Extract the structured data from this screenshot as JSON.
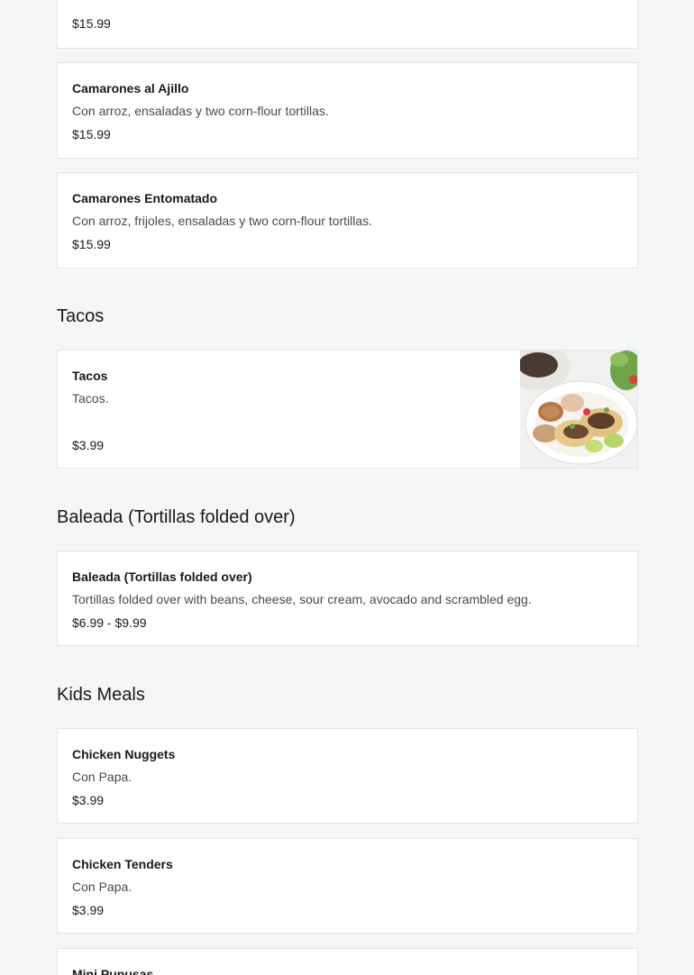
{
  "menu": {
    "top_partial_item": {
      "price": "$15.99"
    },
    "mariscos_items": [
      {
        "name": "Camarones al Ajillo",
        "description": "Con arroz, ensaladas y two corn-flour tortillas.",
        "price": "$15.99"
      },
      {
        "name": "Camarones Entomatado",
        "description": "Con arroz, frijoles, ensaladas y two corn-flour tortillas.",
        "price": "$15.99"
      }
    ],
    "sections": [
      {
        "title": "Tacos",
        "items": [
          {
            "name": "Tacos",
            "description": "Tacos.",
            "price": "$3.99",
            "image": "tacos-plate-photo"
          }
        ]
      },
      {
        "title": "Baleada (Tortillas folded over)",
        "items": [
          {
            "name": "Baleada (Tortillas folded over)",
            "description": "Tortillas folded over with beans, cheese, sour cream, avocado and scrambled egg.",
            "price": "$6.99 - $9.99"
          }
        ]
      },
      {
        "title": "Kids Meals",
        "items": [
          {
            "name": "Chicken Nuggets",
            "description": "Con Papa.",
            "price": "$3.99"
          },
          {
            "name": "Chicken Tenders",
            "description": "Con Papa.",
            "price": "$3.99"
          },
          {
            "name": "Mini Pupusas"
          }
        ]
      }
    ]
  },
  "colors": {
    "background": "#f5f6f8",
    "card": "#ffffff",
    "border": "#e3e4e6",
    "text": "#191919",
    "muted_text": "#4a4a4a"
  }
}
